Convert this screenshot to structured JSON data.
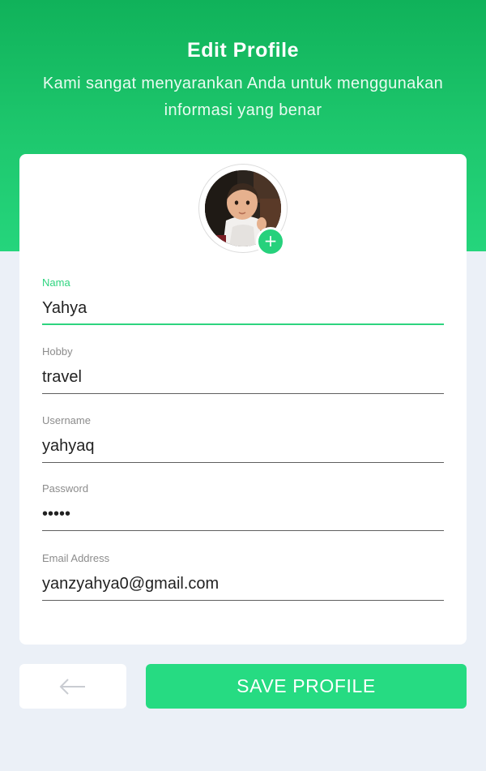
{
  "header": {
    "title": "Edit Profile",
    "subtitle": "Kami sangat menyarankan Anda untuk menggunakan informasi yang benar"
  },
  "avatar": {
    "add_label": "+",
    "add_icon": "plus-icon"
  },
  "form": {
    "fields": [
      {
        "label": "Nama",
        "value": "Yahya",
        "type": "text",
        "active": true
      },
      {
        "label": "Hobby",
        "value": "travel",
        "type": "text",
        "active": false
      },
      {
        "label": "Username",
        "value": "yahyaq",
        "type": "text",
        "active": false
      },
      {
        "label": "Password",
        "value": "•••••",
        "type": "password",
        "active": false
      },
      {
        "label": "Email Address",
        "value": "yanzyahya0@gmail.com",
        "type": "text",
        "active": false
      }
    ]
  },
  "actions": {
    "back_icon": "arrow-left-icon",
    "save_label": "SAVE PROFILE"
  },
  "colors": {
    "header_gradient_top": "#10b25a",
    "header_gradient_bottom": "#25d57c",
    "accent": "#2ed47f",
    "save_button": "#26db82",
    "background": "#ebf0f7"
  }
}
